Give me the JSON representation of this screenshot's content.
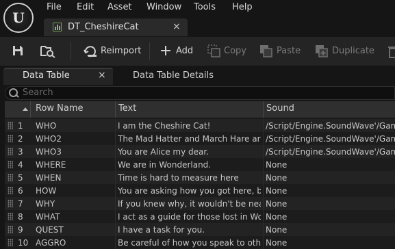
{
  "menu": [
    "File",
    "Edit",
    "Asset",
    "Window",
    "Tools",
    "Help"
  ],
  "logo_text": "U",
  "asset_tab": {
    "label": "DT_CheshireCat",
    "close": "×"
  },
  "toolbar": {
    "reimport": "Reimport",
    "add": "Add",
    "copy": "Copy",
    "paste": "Paste",
    "duplicate": "Duplicate"
  },
  "panel_tabs": {
    "data_table": "Data Table",
    "data_table_close": "×",
    "details": "Data Table Details"
  },
  "search": {
    "placeholder": "Search"
  },
  "table": {
    "columns": [
      "Row Name",
      "Text",
      "Sound"
    ],
    "rows": [
      {
        "num": "1",
        "name": "WHO",
        "text": "I am the Cheshire Cat!",
        "sound": "/Script/Engine.SoundWave'/Game"
      },
      {
        "num": "2",
        "name": "WHO2",
        "text": "The Mad Hatter and March Hare are he",
        "sound": "/Script/Engine.SoundWave'/Game"
      },
      {
        "num": "3",
        "name": "WHO3",
        "text": "You are Alice my dear.",
        "sound": "/Script/Engine.SoundWave'/Game"
      },
      {
        "num": "4",
        "name": "WHERE",
        "text": "We are in Wonderland.",
        "sound": "None"
      },
      {
        "num": "5",
        "name": "WHEN",
        "text": "Time is hard to measure here",
        "sound": "None"
      },
      {
        "num": "6",
        "name": "HOW",
        "text": "You are asking how you got here, but I",
        "sound": "None"
      },
      {
        "num": "7",
        "name": "WHY",
        "text": "If you knew why, it wouldn't be nearly a",
        "sound": "None"
      },
      {
        "num": "8",
        "name": "WHAT",
        "text": "I act as a guide for those lost in Wonde",
        "sound": "None"
      },
      {
        "num": "9",
        "name": "QUEST",
        "text": "I have a task for you.",
        "sound": "None"
      },
      {
        "num": "10",
        "name": "AGGRO",
        "text": "Be careful of how you speak to others i",
        "sound": "None"
      }
    ]
  },
  "colors": {
    "accent_green": "#7dc05c",
    "background": "#151515",
    "toolbar": "#242424"
  }
}
